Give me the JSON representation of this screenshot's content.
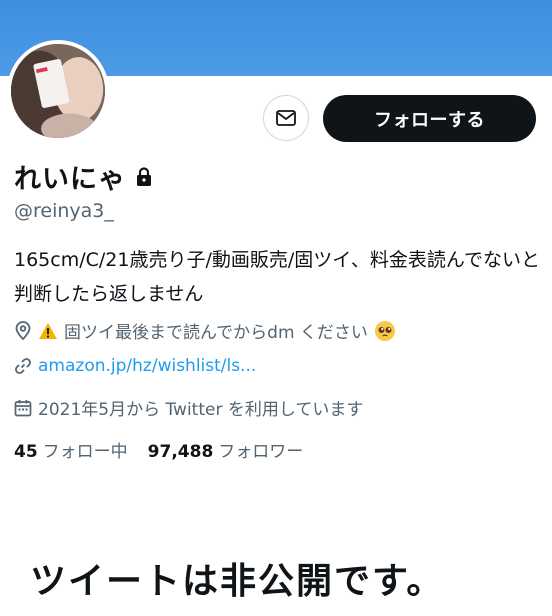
{
  "profile": {
    "name": "れいにゃ",
    "handle": "@reinya3_",
    "bio": "165cm/C/21歳売り子/動画販売/固ツイ、料金表読んでないと判断したら返しません",
    "location_text": "固ツイ最後まで読んでからdm ください",
    "website": "amazon.jp/hz/wishlist/ls...",
    "joined": "2021年5月から Twitter を利用しています",
    "following_count": "45",
    "following_label": "フォロー中",
    "followers_count": "97,488",
    "followers_label": "フォロワー",
    "protected_icon": "lock-icon"
  },
  "actions": {
    "message_icon": "envelope-icon",
    "follow_label": "フォローする"
  },
  "caption": "ツイートは非公開です。",
  "colors": {
    "banner": "#4d9be6",
    "follow_button": "#0f1419",
    "link": "#1d9bf0",
    "secondary_text": "#536471"
  }
}
